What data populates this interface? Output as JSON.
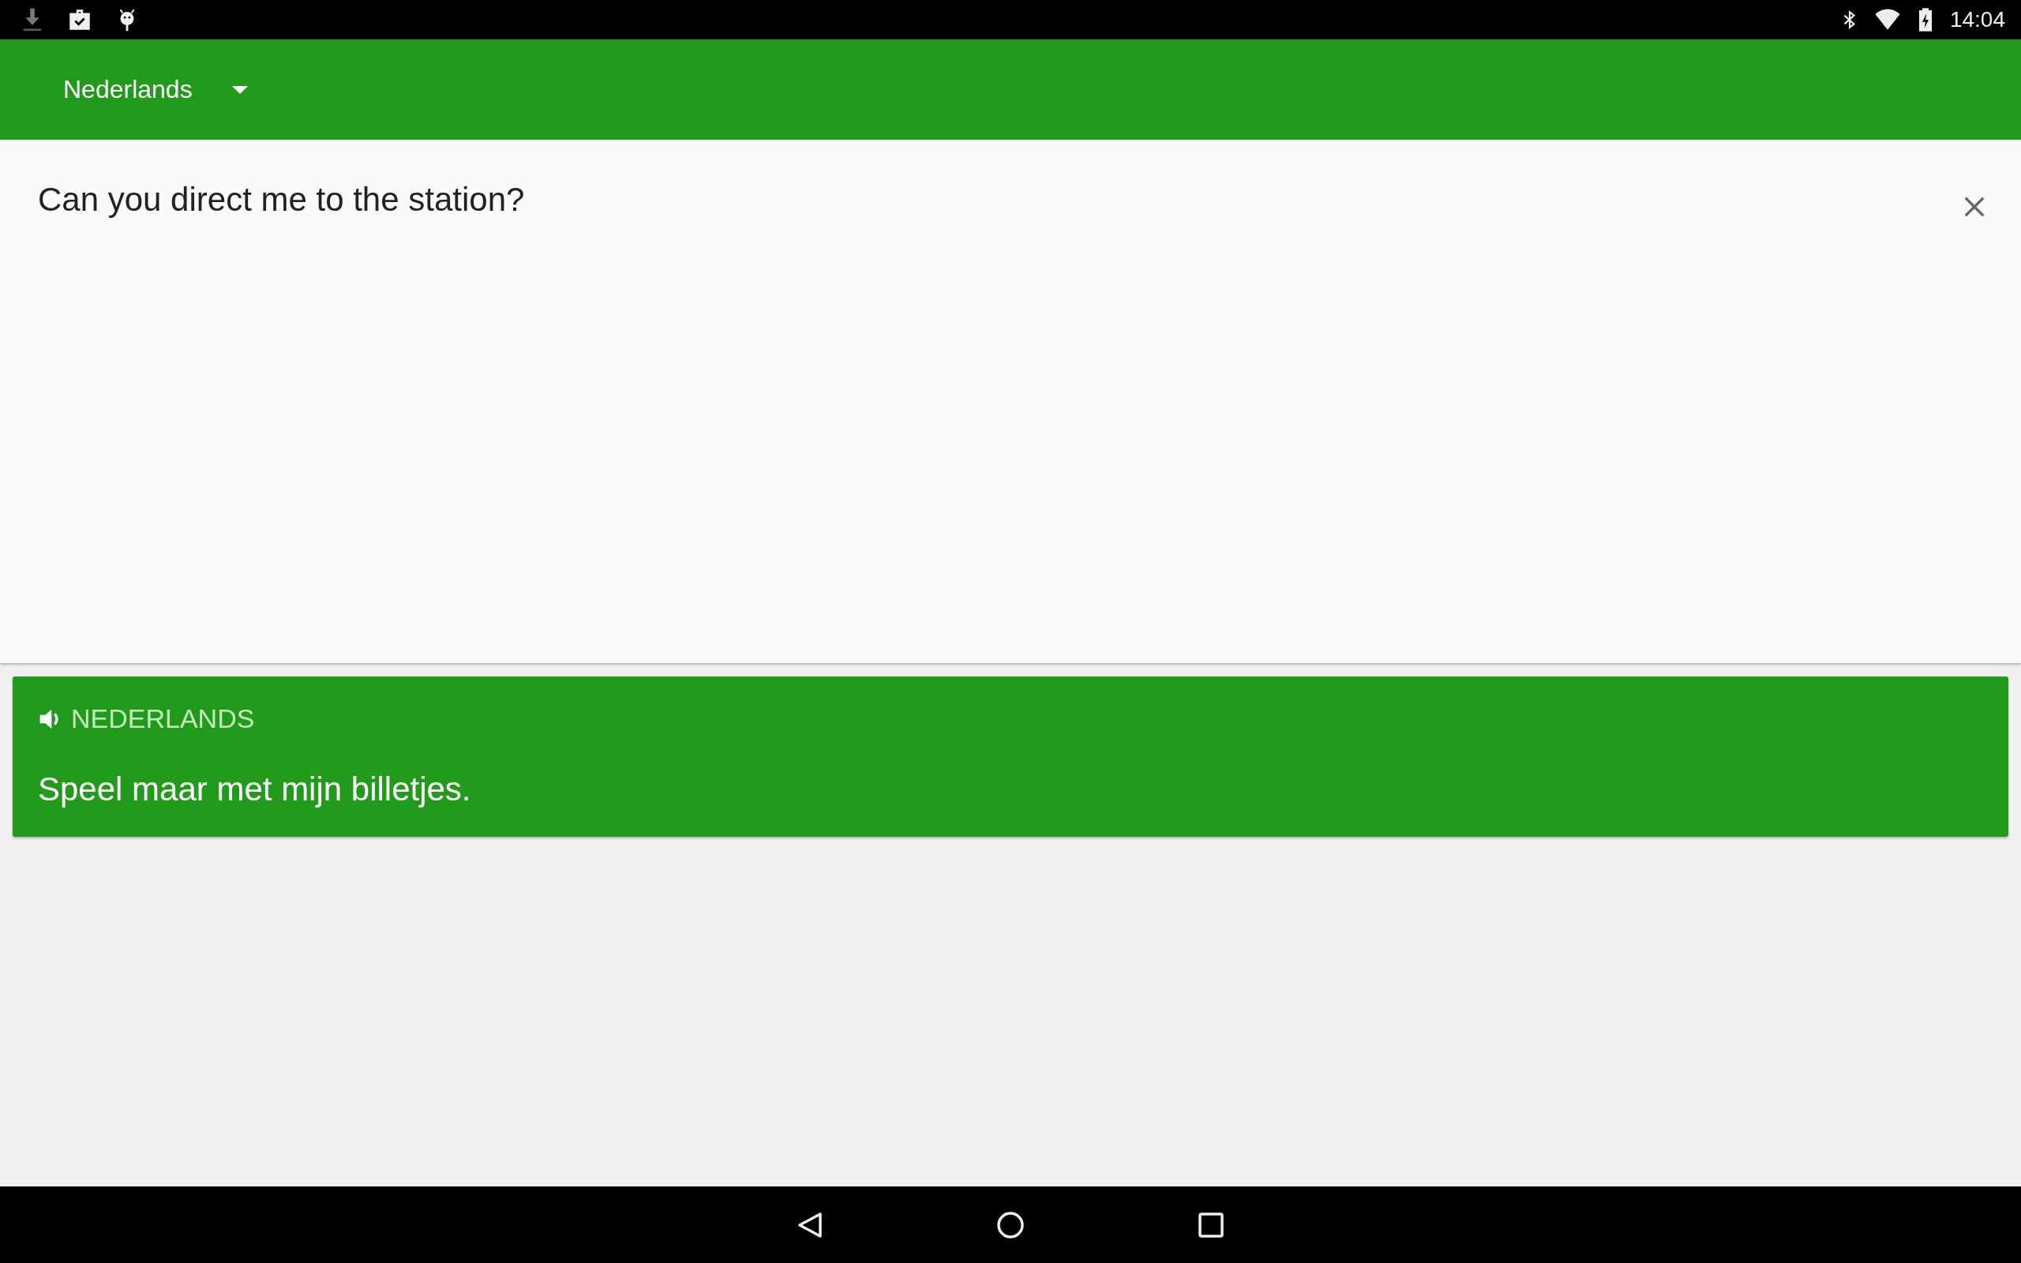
{
  "status_bar": {
    "time": "14:04"
  },
  "app_bar": {
    "language": "Nederlands"
  },
  "input": {
    "value": "Can you direct me to the station?"
  },
  "result": {
    "language": "NEDERLANDS",
    "text": "Speel maar met mijn billetjes."
  }
}
